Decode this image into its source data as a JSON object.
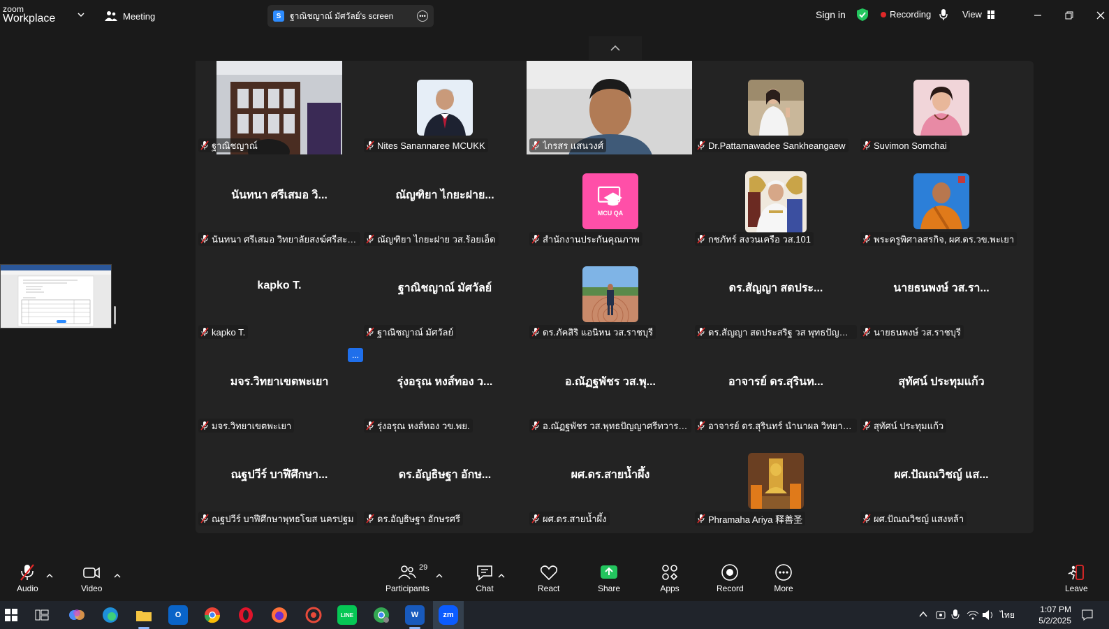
{
  "titlebar": {
    "logo_line1": "zoom",
    "logo_line2": "Workplace",
    "meeting_label": "Meeting",
    "share_title": "ฐาณิชญาณ์ มัศวัลย์'s screen",
    "sign_in": "Sign in",
    "recording": "Recording",
    "view": "View"
  },
  "tiles": [
    {
      "display": "",
      "label": "ฐาณิชญาณ์",
      "kind": "video-room",
      "active": true
    },
    {
      "display": "",
      "label": "Nites Sanannaree MCUKK",
      "kind": "avatar-man-suit"
    },
    {
      "display": "",
      "label": "ไกรสร แสนวงศ์",
      "kind": "video-man"
    },
    {
      "display": "",
      "label": "Dr.Pattamawadee Sankheangaew",
      "kind": "avatar-woman-white"
    },
    {
      "display": "",
      "label": "Suvimon Somchai",
      "kind": "avatar-woman-pink"
    },
    {
      "display": "นันทนา ศรีเสมอ วิ...",
      "label": "นันทนา ศรีเสมอ วิทยาลัยสงฆ์ศรีสะเกษ"
    },
    {
      "display": "ณัญฑิยา ไกยะฝาย...",
      "label": "ณัญฑิยา ไกยะฝาย วส.ร้อยเอ็ด"
    },
    {
      "display": "",
      "label": "สำนักงานประกันคุณภาพ",
      "kind": "avatar-mcuqa",
      "badge": "MCU QA"
    },
    {
      "display": "",
      "label": "กชภัทร์ สงวนเครือ วส.101",
      "kind": "avatar-uniform"
    },
    {
      "display": "",
      "label": "พระครูพิศาลสรกิจ, ผศ.ดร.วข.พะเยา",
      "kind": "avatar-monk"
    },
    {
      "display": "kapko T.",
      "label": "kapko T."
    },
    {
      "display": "ฐาณิชญาณ์ มัศวัลย์",
      "label": "ฐาณิชญาณ์ มัศวัลย์"
    },
    {
      "display": "",
      "label": "ดร.ภัคสิริ แอนิหน วส.ราชบุรี",
      "kind": "avatar-outdoor"
    },
    {
      "display": "ดร.สัญญา สดประ...",
      "label": "ดร.สัญญา สดประสริฐ วส พุทธปัญญาฯ"
    },
    {
      "display": "นายธนพงษ์ วส.รา...",
      "label": "นายธนพงษ์ วส.ราชบุรี"
    },
    {
      "display": "มจร.วิทยาเขตพะเยา",
      "label": "มจร.วิทยาเขตพะเยา"
    },
    {
      "display": "รุ่งอรุณ หงส์ทอง ว...",
      "label": "รุ่งอรุณ หงส์ทอง วข.พย."
    },
    {
      "display": "อ.ณัฏฐพัชร วส.พุ...",
      "label": "อ.ณัฏฐพัชร วส.พุทธปัญญาศรีทวารวดี"
    },
    {
      "display": "อาจารย์ ดร.สุรินท...",
      "label": "อาจารย์ ดร.สุรินทร์ นำนาผล วิทยาลัยสงฆ์..."
    },
    {
      "display": "สุทัศน์ ประทุมแก้ว",
      "label": "สุทัศน์ ประทุมแก้ว"
    },
    {
      "display": "ณฐปวีร์ บาฬีศึกษา...",
      "label": "ณฐปวีร์ บาฬีศึกษาพุทธโฆส นครปฐม"
    },
    {
      "display": "ดร.อัญธิษฐา อักษ...",
      "label": "ดร.อัญธิษฐา อักษรศรี"
    },
    {
      "display": "ผศ.ดร.สายน้ำผึ้ง",
      "label": "ผศ.ดร.สายน้ำผึ้ง"
    },
    {
      "display": "",
      "label": "Phramaha Ariya 释善圣",
      "kind": "avatar-temple"
    },
    {
      "display": "ผศ.ปัณณวิชญ์ แส...",
      "label": "ผศ.ปัณณวิชญ์ แสงหล้า"
    }
  ],
  "toolbar": {
    "audio": "Audio",
    "video": "Video",
    "participants": "Participants",
    "participants_count": "29",
    "chat": "Chat",
    "react": "React",
    "share": "Share",
    "apps": "Apps",
    "record": "Record",
    "more": "More",
    "leave": "Leave"
  },
  "taskbar": {
    "lang": "ไทย",
    "time": "1:07 PM",
    "date": "5/2/2025",
    "zoom_icon": "zm"
  },
  "more_button": "..."
}
